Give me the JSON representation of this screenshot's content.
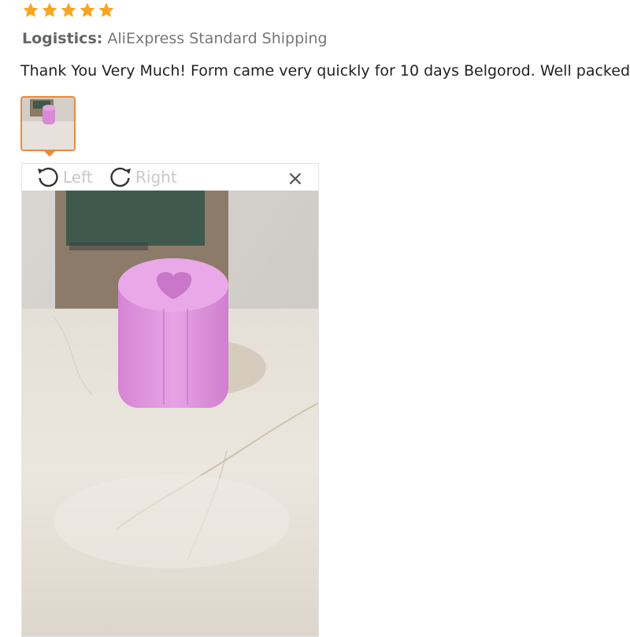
{
  "review": {
    "rating": 5,
    "stars_color": "#f6a623",
    "logistics_label": "Logistics:",
    "logistics_value": "AliExpress Standard Shipping",
    "text": "Thank You Very Much! Form came very quickly for 10 days Belgorod. Well packed"
  },
  "viewer": {
    "rotate_left_label": "Left",
    "rotate_right_label": "Right",
    "close_icon": "close-icon",
    "accent_color": "#e88b3a"
  }
}
